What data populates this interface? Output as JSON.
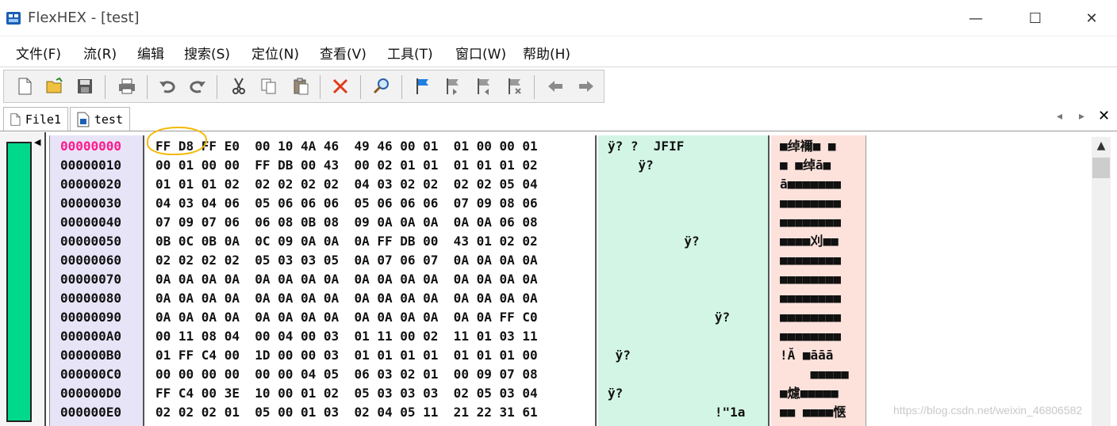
{
  "window": {
    "title": "FlexHEX - [test]",
    "minimize": "—",
    "maximize": "☐",
    "close": "✕"
  },
  "menu": [
    {
      "label": "文件(F)"
    },
    {
      "label": "流(R)"
    },
    {
      "label": "编辑"
    },
    {
      "label": "搜索(S)"
    },
    {
      "label": "定位(N)"
    },
    {
      "label": "查看(V)"
    },
    {
      "label": "工具(T)"
    },
    {
      "label": "窗口(W)"
    },
    {
      "label": "帮助(H)"
    }
  ],
  "tabs": [
    {
      "label": "File1"
    },
    {
      "label": "test"
    }
  ],
  "tab_nav": {
    "prev": "◂",
    "next": "▸",
    "close": "✕"
  },
  "scroll": {
    "up": "▲"
  },
  "colors": {
    "accent_green": "#00d98c",
    "addr_bg": "#e8e4f8",
    "ascii_bg": "#d2f5e6",
    "unicode_bg": "#fde2dc",
    "current_addr": "#ff1a8c",
    "highlight": "#f6b700"
  },
  "rows": [
    {
      "addr": "00000000",
      "hex": "FF D8 FF E0  00 10 4A 46  49 46 00 01  01 00 00 01",
      "ascii": "ÿ? ?  JFIF",
      "uni": "■绰襧■ ■"
    },
    {
      "addr": "00000010",
      "hex": "00 01 00 00  FF DB 00 43  00 02 01 01  01 01 01 02",
      "ascii": "    ÿ?",
      "uni": "■ ■绰ā■"
    },
    {
      "addr": "00000020",
      "hex": "01 01 01 02  02 02 02 02  04 03 02 02  02 02 05 04",
      "ascii": "",
      "uni": "ā■■■■■■■"
    },
    {
      "addr": "00000030",
      "hex": "04 03 04 06  05 06 06 06  05 06 06 06  07 09 08 06",
      "ascii": "",
      "uni": "■■■■■■■■"
    },
    {
      "addr": "00000040",
      "hex": "07 09 07 06  06 08 0B 08  09 0A 0A 0A  0A 0A 06 08",
      "ascii": "",
      "uni": "■■■■■■■■"
    },
    {
      "addr": "00000050",
      "hex": "0B 0C 0B 0A  0C 09 0A 0A  0A FF DB 00  43 01 02 02",
      "ascii": "          ÿ?",
      "uni": "■■■■刈■■"
    },
    {
      "addr": "00000060",
      "hex": "02 02 02 02  05 03 03 05  0A 07 06 07  0A 0A 0A 0A",
      "ascii": "",
      "uni": "■■■■■■■■"
    },
    {
      "addr": "00000070",
      "hex": "0A 0A 0A 0A  0A 0A 0A 0A  0A 0A 0A 0A  0A 0A 0A 0A",
      "ascii": "",
      "uni": "■■■■■■■■"
    },
    {
      "addr": "00000080",
      "hex": "0A 0A 0A 0A  0A 0A 0A 0A  0A 0A 0A 0A  0A 0A 0A 0A",
      "ascii": "",
      "uni": "■■■■■■■■"
    },
    {
      "addr": "00000090",
      "hex": "0A 0A 0A 0A  0A 0A 0A 0A  0A 0A 0A 0A  0A 0A FF C0",
      "ascii": "              ÿ?",
      "uni": "■■■■■■■■"
    },
    {
      "addr": "000000A0",
      "hex": "00 11 08 04  00 04 00 03  01 11 00 02  11 01 03 11",
      "ascii": "",
      "uni": "■■■■■■■■"
    },
    {
      "addr": "000000B0",
      "hex": "01 FF C4 00  1D 00 00 03  01 01 01 01  01 01 01 00",
      "ascii": " ÿ?",
      "uni": "!Ă ■āāā"
    },
    {
      "addr": "000000C0",
      "hex": "00 00 00 00  00 00 04 05  06 03 02 01  00 09 07 08",
      "ascii": "",
      "uni": "    ■■■■■"
    },
    {
      "addr": "000000D0",
      "hex": "FF C4 00 3E  10 00 01 02  05 03 03 03  02 05 03 04",
      "ascii": "ÿ?",
      "uni": "■爈■■■■■"
    },
    {
      "addr": "000000E0",
      "hex": "02 02 02 01  05 00 01 03  02 04 05 11  21 22 31 61",
      "ascii": "              !\"1a",
      "uni": "■■ ■■■■惬"
    }
  ],
  "watermark": "https://blog.csdn.net/weixin_46806582"
}
